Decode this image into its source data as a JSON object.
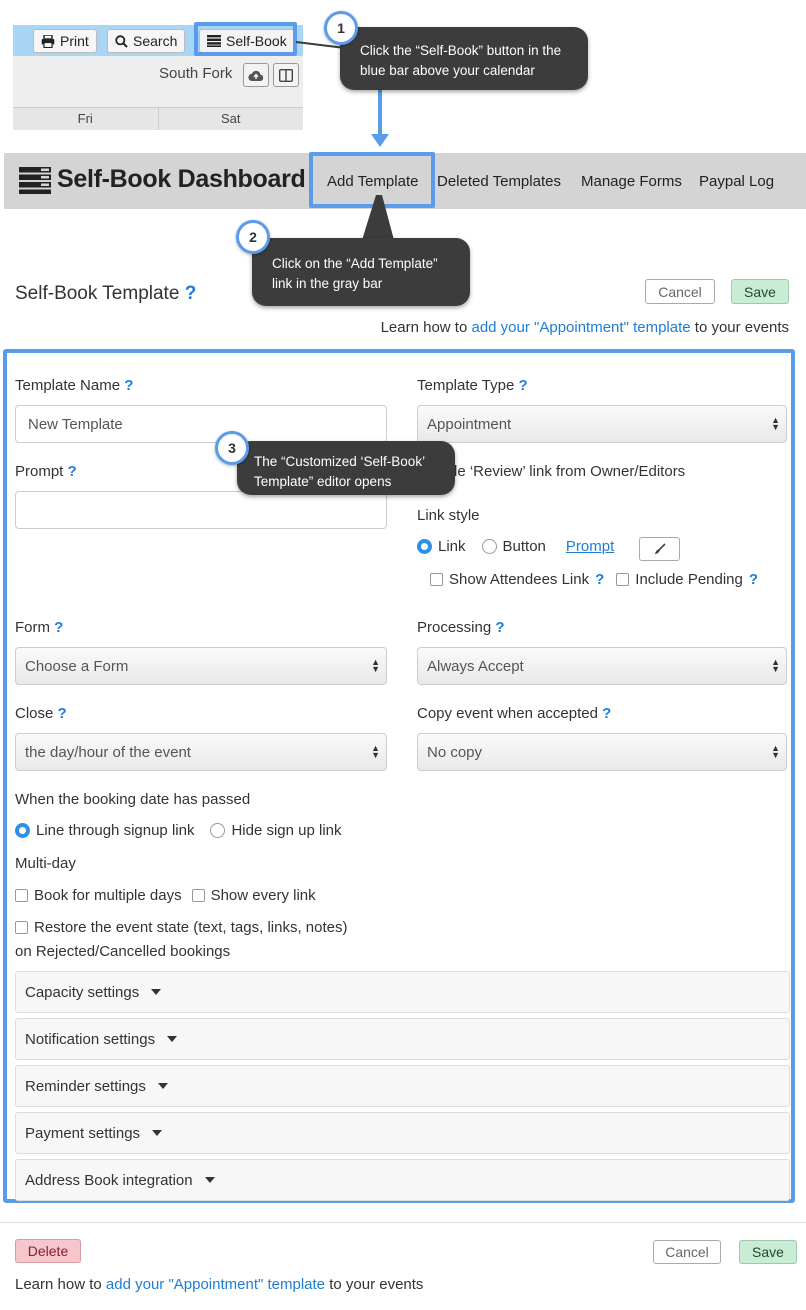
{
  "toolbar": {
    "print_label": "Print",
    "search_label": "Search",
    "selfbook_label": "Self-Book",
    "location": "South Fork",
    "days": [
      "Fri",
      "Sat"
    ]
  },
  "callouts": {
    "step1": {
      "number": "1",
      "text": "Click the “Self-Book” button in the blue bar above your calendar"
    },
    "step2": {
      "number": "2",
      "text": "Click on the “Add Template” link in the gray bar"
    },
    "step3": {
      "number": "3",
      "text": "The “Customized ‘Self-Book’ Template” editor opens"
    }
  },
  "dashboard": {
    "title": "Self-Book Dashboard",
    "nav": [
      "Add Template",
      "Deleted Templates",
      "Manage Forms",
      "Paypal Log"
    ]
  },
  "template_header": {
    "title": "Self-Book Template",
    "help": "?",
    "cancel_label": "Cancel",
    "save_label": "Save",
    "learn_prefix": "Learn how to",
    "learn_link": "add your \"Appointment\" template",
    "learn_suffix": "to your events"
  },
  "form": {
    "template_name_label": "Template Name",
    "template_name_value": "New Template",
    "template_type_label": "Template Type",
    "template_type_value": "Appointment",
    "prompt_label": "Prompt",
    "prompt_value": "",
    "hide_review_label": "Hide ‘Review’ link from Owner/Editors",
    "hide_review_visible": "de ‘Review’ link from Owner/Editors",
    "link_style_label": "Link style",
    "link_option": "Link",
    "button_option": "Button",
    "prompt_link": "Prompt",
    "show_attendees_label": "Show Attendees Link",
    "include_pending_label": "Include Pending",
    "form_label": "Form",
    "form_value": "Choose a Form",
    "processing_label": "Processing",
    "processing_value": "Always Accept",
    "close_label": "Close",
    "close_value": "the day/hour of the event",
    "copy_label": "Copy event when accepted",
    "copy_value": "No copy",
    "passed_label": "When the booking date has passed",
    "line_through_option": "Line through signup link",
    "hide_signup_option": "Hide sign up link",
    "multiday_label": "Multi-day",
    "book_multiple_label": "Book for multiple days",
    "show_every_label": "Show every link",
    "restore_line1": "Restore the event state (text, tags, links, notes)",
    "restore_line2": "on Rejected/Cancelled bookings"
  },
  "accordions": [
    "Capacity settings",
    "Notification settings",
    "Reminder settings",
    "Payment settings",
    "Address Book integration"
  ],
  "footer": {
    "delete_label": "Delete",
    "cancel_label": "Cancel",
    "save_label": "Save",
    "learn_prefix": "Learn how to",
    "learn_link": "add your \"Appointment\" template",
    "learn_suffix": "to your events"
  },
  "colors": {
    "highlight": "#5b9bec",
    "link": "#1f7dd6",
    "save_bg": "#c9ecd4",
    "delete_bg": "#f5c7cc",
    "callout_bg": "#3c3c3c",
    "toolbar_blue": "#a9d6f5"
  }
}
